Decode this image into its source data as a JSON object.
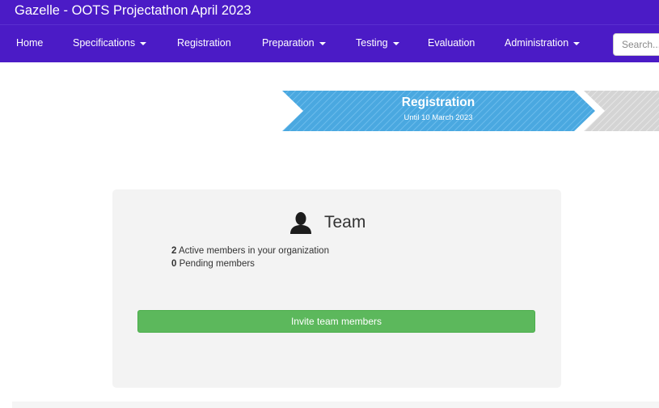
{
  "app": {
    "title": "Gazelle - OOTS Projectathon April 2023"
  },
  "nav": {
    "items": [
      {
        "label": "Home",
        "dropdown": false
      },
      {
        "label": "Specifications",
        "dropdown": true
      },
      {
        "label": "Registration",
        "dropdown": false
      },
      {
        "label": "Preparation",
        "dropdown": true
      },
      {
        "label": "Testing",
        "dropdown": true
      },
      {
        "label": "Evaluation",
        "dropdown": false
      },
      {
        "label": "Administration",
        "dropdown": true
      }
    ],
    "search_placeholder": "Search..."
  },
  "stepper": {
    "current_step": {
      "title": "Registration",
      "subtitle": "Until 10 March 2023"
    },
    "colors": {
      "active": "#4aa8e0",
      "inactive": "#d6d6d6"
    }
  },
  "team": {
    "icon": "user-icon",
    "title": "Team",
    "active_count": "2",
    "active_label": " Active members in your organization",
    "pending_count": "0",
    "pending_label": " Pending members",
    "invite_label": "Invite team members"
  },
  "colors": {
    "brand": "#4b1bc6",
    "success": "#5cb85c",
    "card": "#f3f3f3"
  }
}
